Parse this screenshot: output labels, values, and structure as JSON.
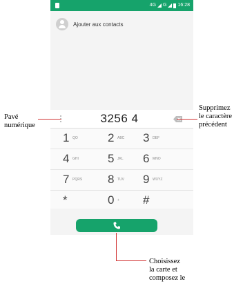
{
  "status_bar": {
    "network": "4G",
    "network2": "G",
    "time": "16:28"
  },
  "contacts": {
    "add_label": "Ajouter aux contacts"
  },
  "dialer": {
    "number": "3256 4"
  },
  "keys": [
    [
      {
        "d": "1",
        "l": "QO"
      },
      {
        "d": "2",
        "l": "ABC"
      },
      {
        "d": "3",
        "l": "DEF"
      }
    ],
    [
      {
        "d": "4",
        "l": "GHI"
      },
      {
        "d": "5",
        "l": "JKL"
      },
      {
        "d": "6",
        "l": "MNO"
      }
    ],
    [
      {
        "d": "7",
        "l": "PQRS"
      },
      {
        "d": "8",
        "l": "TUV"
      },
      {
        "d": "9",
        "l": "WXYZ"
      }
    ],
    [
      {
        "d": "*",
        "l": ""
      },
      {
        "d": "0",
        "l": "+"
      },
      {
        "d": "#",
        "l": ""
      }
    ]
  ],
  "annotations": {
    "keypad_line1": "Pavé",
    "keypad_line2": "numérique",
    "delete_line1": "Supprimez",
    "delete_line2": "le caractère",
    "delete_line3": "précédent",
    "call_line1": "Choisissez",
    "call_line2": "la carte et",
    "call_line3": "composez le"
  },
  "colors": {
    "accent": "#16a36b",
    "annotation": "#d13333"
  }
}
